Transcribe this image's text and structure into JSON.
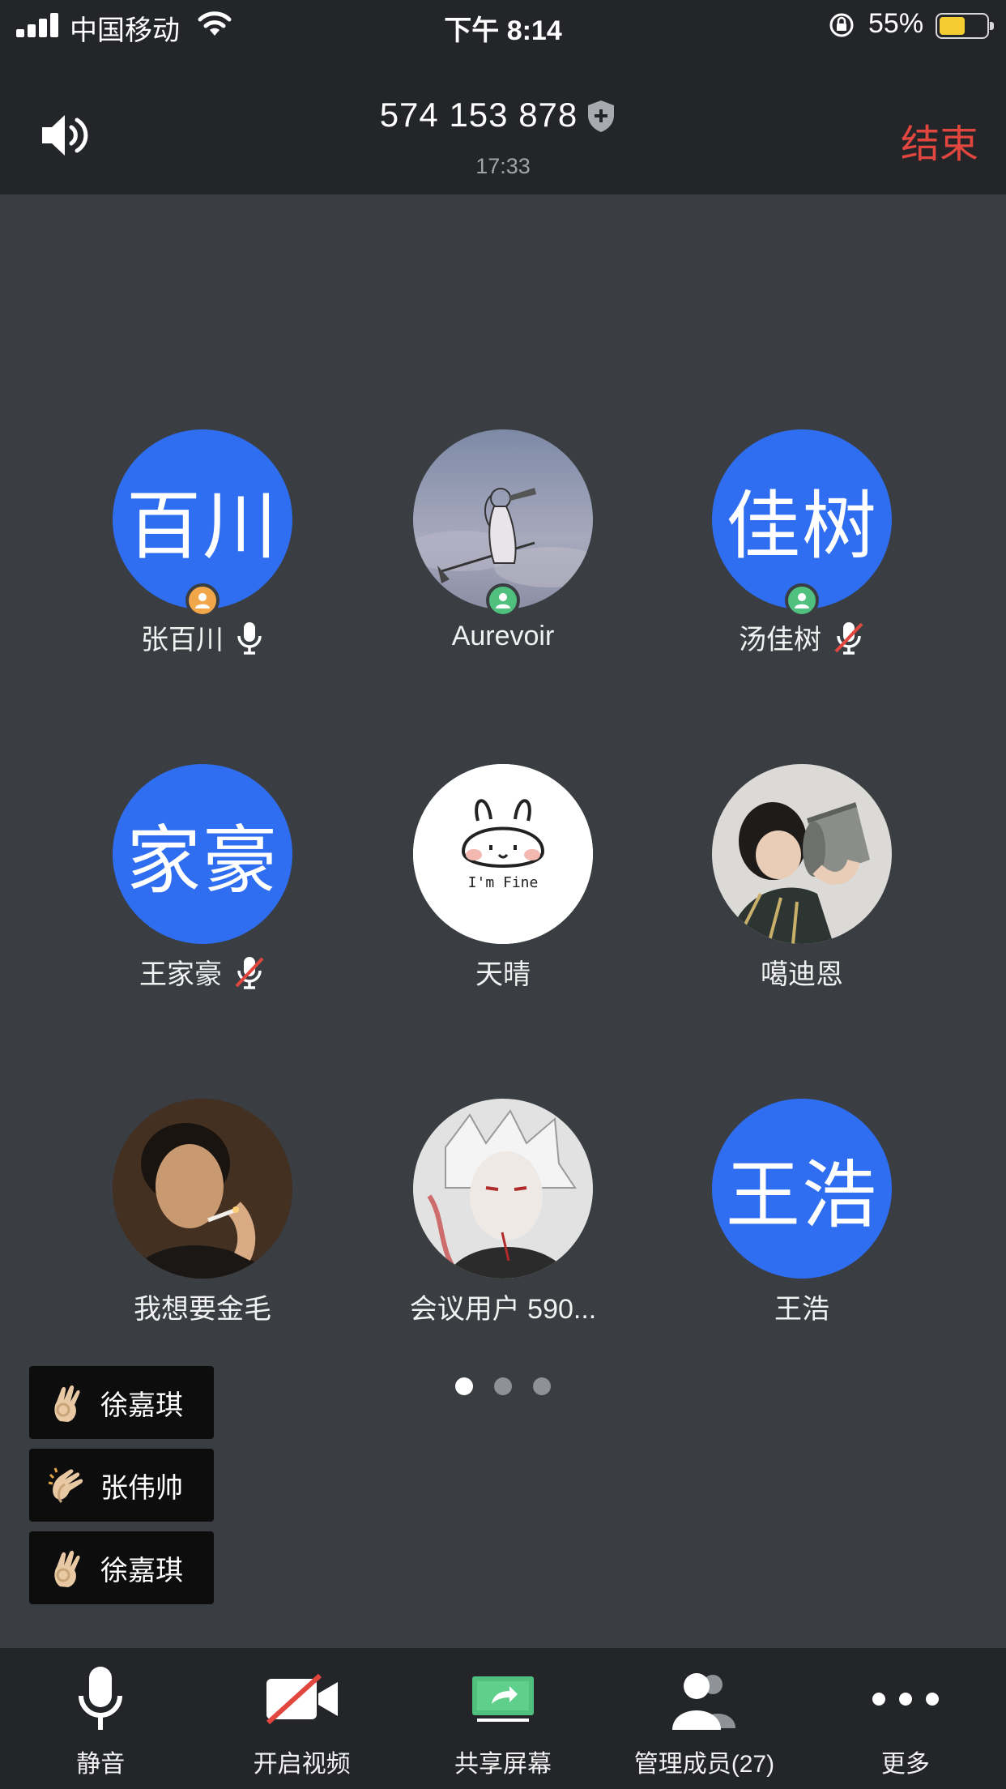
{
  "status_bar": {
    "carrier": "中国移动",
    "time": "下午 8:14",
    "battery_percent": "55%",
    "battery_level": 0.55
  },
  "header": {
    "meeting_id": "574 153 878",
    "duration": "17:33",
    "end_label": "结束"
  },
  "participants": [
    {
      "avatar_text": "百川",
      "name": "张百川",
      "role": "host",
      "mic": "on"
    },
    {
      "avatar_text": "",
      "name": "Aurevoir",
      "role": "cohost",
      "mic": "none"
    },
    {
      "avatar_text": "佳树",
      "name": "汤佳树",
      "role": "cohost",
      "mic": "muted"
    },
    {
      "avatar_text": "家豪",
      "name": "王家豪",
      "role": "",
      "mic": "muted"
    },
    {
      "avatar_text": "",
      "name": "天晴",
      "role": "",
      "mic": "none",
      "avatar_caption": "I'm Fine"
    },
    {
      "avatar_text": "",
      "name": "噶迪恩",
      "role": "",
      "mic": "none"
    },
    {
      "avatar_text": "",
      "name": "我想要金毛",
      "role": "",
      "mic": "none"
    },
    {
      "avatar_text": "",
      "name": "会议用户 590...",
      "role": "",
      "mic": "none"
    },
    {
      "avatar_text": "王浩",
      "name": "王浩",
      "role": "",
      "mic": "none"
    }
  ],
  "pagination": {
    "pages": 3,
    "current": 1
  },
  "reactions": [
    {
      "emoji": "ok-hand",
      "name": "徐嘉琪"
    },
    {
      "emoji": "clapping-hands",
      "name": "张伟帅"
    },
    {
      "emoji": "ok-hand",
      "name": "徐嘉琪"
    }
  ],
  "toolbar": {
    "mute": "静音",
    "video": "开启视频",
    "share": "共享屏幕",
    "members": "管理成员(27)",
    "more": "更多"
  },
  "colors": {
    "accent_blue": "#2f6ef0",
    "end_red": "#e2473f",
    "host_badge": "#f1a64a",
    "cohost_badge": "#4fc07d",
    "share_green": "#4fc07d"
  }
}
